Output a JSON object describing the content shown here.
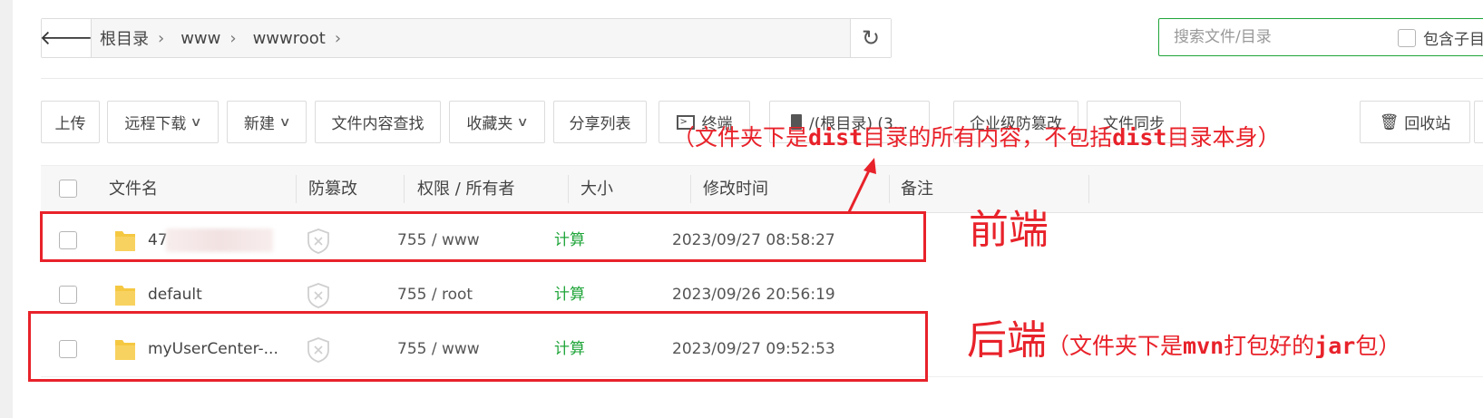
{
  "path": {
    "back_icon": "arrow-left-icon",
    "crumbs": [
      "根目录",
      "www",
      "wwwroot"
    ],
    "refresh_icon": "refresh-icon"
  },
  "search": {
    "placeholder": "搜索文件/目录",
    "include_sub_label": "包含子目"
  },
  "toolbar": {
    "upload": "上传",
    "remote_download": "远程下载",
    "new": "新建",
    "content_search": "文件内容查找",
    "favorites": "收藏夹",
    "share_list": "分享列表",
    "terminal": "终端",
    "disk": "/(根目录) (3...",
    "tamper_proof": "企业级防篡改",
    "file_sync": "文件同步",
    "recycle_bin": "回收站"
  },
  "table": {
    "headers": {
      "name": "文件名",
      "tamper": "防篡改",
      "perm_owner": "权限 / 所有者",
      "size": "大小",
      "mtime": "修改时间",
      "remark": "备注"
    },
    "rows": [
      {
        "name": "47.",
        "perm": "755 / www",
        "size": "计算",
        "mtime": "2023/09/27 08:58:27"
      },
      {
        "name": "default",
        "perm": "755 / root",
        "size": "计算",
        "mtime": "2023/09/26 20:56:19"
      },
      {
        "name": "myUserCenter-...",
        "perm": "755 / www",
        "size": "计算",
        "mtime": "2023/09/27 09:52:53"
      }
    ]
  },
  "annotations": {
    "top_note": {
      "p1": "（文件夹下是",
      "b1": "dist",
      "p2": "目录的所有内容，不包括",
      "b2": "dist",
      "p3": "目录本身）"
    },
    "frontend": "前端",
    "backend": "后端",
    "backend_note": {
      "p1": "（文件夹下是",
      "b1": "mvn",
      "p2": "打包好的",
      "b2": "jar",
      "p3": "包）"
    }
  },
  "colors": {
    "accent": "#20a53a",
    "annotation": "#e8222a",
    "folder": "#f5c842"
  }
}
